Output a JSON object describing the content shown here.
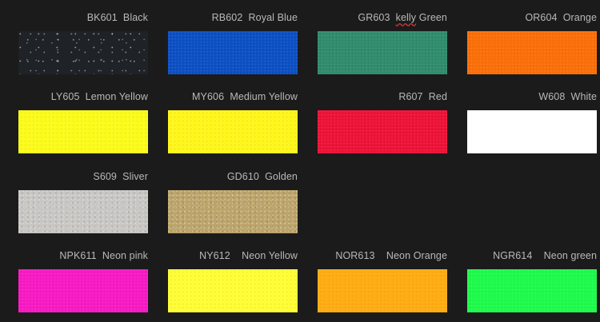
{
  "swatches": [
    {
      "code": "BK601",
      "name": "Black",
      "color": "#1f2226",
      "texture": "glitter"
    },
    {
      "code": "RB602",
      "name": "Royal Blue",
      "color": "#0b4fc4",
      "texture": "fine"
    },
    {
      "code": "GR603",
      "name": "kelly Green",
      "color": "#2f8b6c",
      "texture": "fine"
    },
    {
      "code": "OR604",
      "name": "Orange",
      "color": "#fb6e07",
      "texture": "fine"
    },
    {
      "code": "LY605",
      "name": "Lemon Yellow",
      "color": "#fcfb1a",
      "texture": "fine"
    },
    {
      "code": "MY606",
      "name": "Medium Yellow",
      "color": "#fff61a",
      "texture": "fine"
    },
    {
      "code": "R607",
      "name": "Red",
      "color": "#ee1137",
      "texture": "fine"
    },
    {
      "code": "W608",
      "name": "White",
      "color": "#ffffff",
      "texture": "none"
    },
    {
      "code": "S609",
      "name": "Sliver",
      "color": "#c8c6c3",
      "texture": "metal"
    },
    {
      "code": "GD610",
      "name": "Golden",
      "color": "#bca46a",
      "texture": "metal"
    },
    {
      "code": "NPK611",
      "name": "Neon pink",
      "color": "#f719c3",
      "texture": "fine"
    },
    {
      "code": "NY612",
      "name": "Neon Yellow",
      "color": "#fffd34",
      "texture": "fine"
    },
    {
      "code": "NOR613",
      "name": "Neon Orange",
      "color": "#ffac10",
      "texture": "fine"
    },
    {
      "code": "NGR614",
      "name": "Neon green",
      "color": "#1dfb4a",
      "texture": "fine"
    }
  ]
}
